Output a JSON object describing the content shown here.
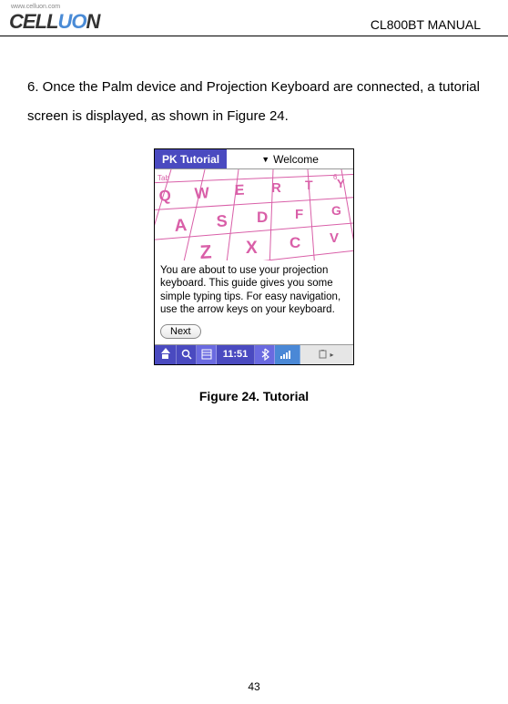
{
  "header": {
    "logo_url": "www.celluon.com",
    "manual_title": "CL800BT MANUAL"
  },
  "body": {
    "paragraph": "6. Once the Palm device and Projection Keyboard are connected, a tutorial screen is displayed, as shown in Figure 24."
  },
  "device": {
    "titlebar_app": "PK Tutorial",
    "titlebar_section": "Welcome",
    "tutorial_message": "You are about to use your projection keyboard. This guide gives you some simple typing tips. For easy navigation, use the arrow keys on your keyboard.",
    "next_label": "Next",
    "taskbar_time": "11:51"
  },
  "figure_caption": "Figure 24. Tutorial",
  "page_number": "43"
}
